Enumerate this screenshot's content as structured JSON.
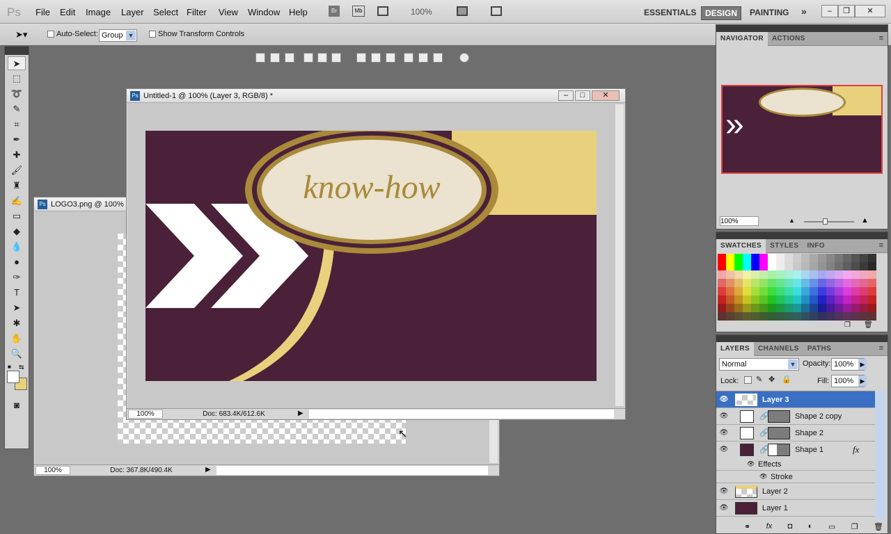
{
  "app": {
    "logo": "Ps"
  },
  "menu": [
    "File",
    "Edit",
    "Image",
    "Layer",
    "Select",
    "Filter",
    "View",
    "Window",
    "Help"
  ],
  "appbar": {
    "bridge": "Br",
    "minibridge": "Mb",
    "zoom": "100%"
  },
  "workspaces": [
    "ESSENTIALS",
    "DESIGN",
    "PAINTING"
  ],
  "workspace_active": "DESIGN",
  "workspace_more": "»",
  "options": {
    "auto_select_label": "Auto-Select:",
    "auto_select_value": "Group",
    "show_transform_label": "Show Transform Controls",
    "auto_select_checked": false,
    "show_transform_checked": false
  },
  "doc_front": {
    "title": "Untitled-1 @ 100% (Layer 3, RGB/8) *",
    "zoom": "100%",
    "doc_size": "Doc: 683.4K/612.6K",
    "art_text": "know-how"
  },
  "doc_back": {
    "title": "LOGO3.png @ 100%",
    "zoom": "100%",
    "doc_size": "Doc: 367.8K/490.4K"
  },
  "navigator": {
    "tabs": [
      "NAVIGATOR",
      "ACTIONS"
    ],
    "zoom": "100%",
    "zoom_slider_fraction": 0.38
  },
  "swatches": {
    "tabs": [
      "SWATCHES",
      "STYLES",
      "INFO"
    ]
  },
  "layers": {
    "tabs": [
      "LAYERS",
      "CHANNELS",
      "PATHS"
    ],
    "blend_mode": "Normal",
    "opacity_label": "Opacity:",
    "opacity": "100%",
    "lock_label": "Lock:",
    "fill_label": "Fill:",
    "fill": "100%",
    "items": [
      {
        "name": "Layer 3",
        "selected": true
      },
      {
        "name": "Shape 2 copy"
      },
      {
        "name": "Shape 2"
      },
      {
        "name": "Shape 1",
        "fx": "fx"
      },
      {
        "name": "Layer 2"
      },
      {
        "name": "Layer 1"
      }
    ],
    "effects_label": "Effects",
    "stroke_label": "Stroke"
  },
  "colors": {
    "maroon": "#4a2139",
    "gold": "#e9d07c",
    "ring": "#a88a3a",
    "selection": "#3a6fc4"
  }
}
